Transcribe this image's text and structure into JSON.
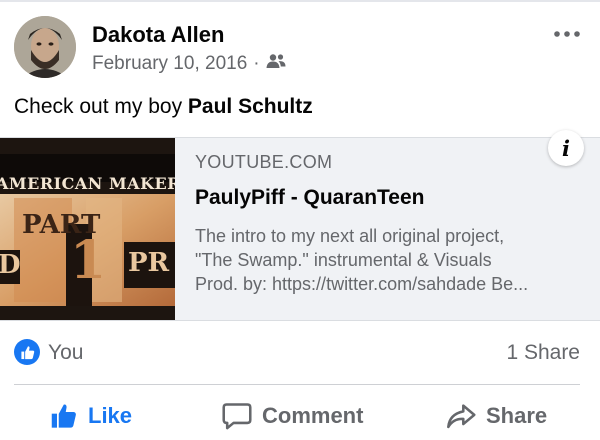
{
  "post": {
    "author": "Dakota Allen",
    "date": "February 10, 2016",
    "separator": "·",
    "audience_icon": "friends-icon",
    "text_prefix": "Check out my boy ",
    "tagged_name": "Paul Schultz"
  },
  "link_preview": {
    "thumbnail_text": {
      "line1": "AMERICAN  MAKER",
      "part": "PART",
      "number": "1",
      "left_letter": "D",
      "right_letters": "PR"
    },
    "domain": "YOUTUBE.COM",
    "title": "PaulyPiff - QuaranTeen",
    "description_lines": [
      "The intro to my next all original project,",
      "\"The Swamp.\" instrumental & Visuals",
      "Prod. by: https://twitter.com/sahdade Be..."
    ],
    "info_icon": "i"
  },
  "reactions": {
    "names": "You",
    "shares": "1 Share"
  },
  "actions": {
    "like": "Like",
    "comment": "Comment",
    "share": "Share"
  },
  "colors": {
    "accent": "#1877f2",
    "muted": "#65676b",
    "card_bg": "#f0f2f5"
  }
}
